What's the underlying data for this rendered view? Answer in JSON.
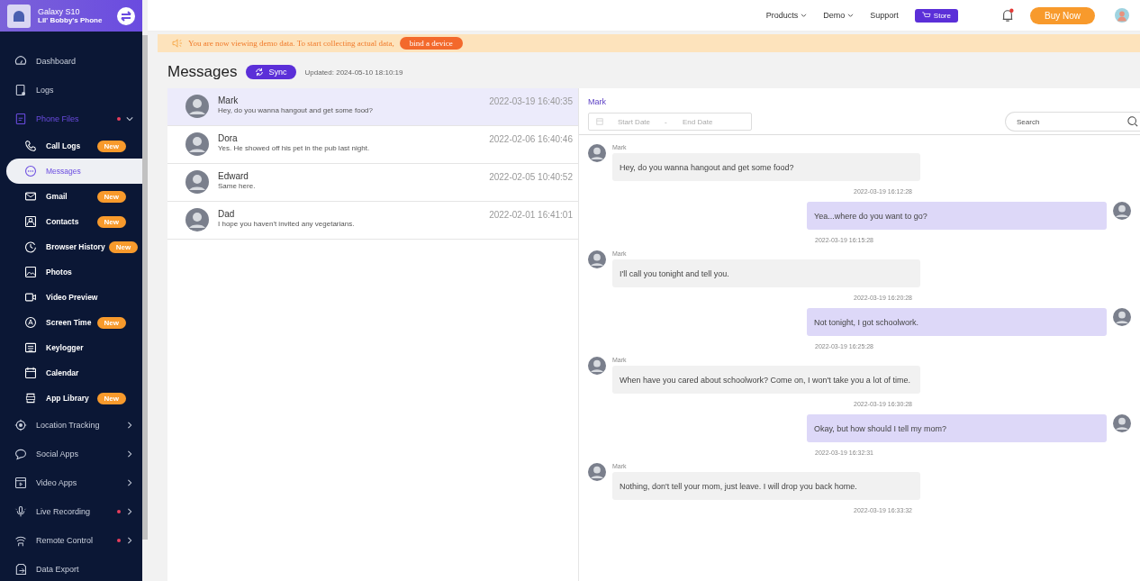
{
  "device": {
    "model": "Galaxy S10",
    "name": "Lil' Bobby's Phone"
  },
  "sidebar": {
    "items": [
      {
        "label": "Dashboard",
        "selected": false
      },
      {
        "label": "Logs",
        "selected": false
      },
      {
        "label": "Phone Files",
        "selected": true,
        "dot": true,
        "expanded": true,
        "children": [
          {
            "label": "Call Logs",
            "badge": "New",
            "selected": false
          },
          {
            "label": "Messages",
            "selected": true
          },
          {
            "label": "Gmail",
            "badge": "New",
            "selected": false
          },
          {
            "label": "Contacts",
            "badge": "New",
            "selected": false
          },
          {
            "label": "Browser History",
            "badge": "New",
            "selected": false
          },
          {
            "label": "Photos",
            "selected": false
          },
          {
            "label": "Video Preview",
            "selected": false
          },
          {
            "label": "Screen Time",
            "badge": "New",
            "selected": false
          },
          {
            "label": "Keylogger",
            "selected": false
          },
          {
            "label": "Calendar",
            "selected": false
          },
          {
            "label": "App Library",
            "badge": "New",
            "selected": false
          }
        ]
      },
      {
        "label": "Location Tracking",
        "selected": false,
        "dot": false,
        "expanded": false
      },
      {
        "label": "Social Apps",
        "selected": false,
        "dot": false,
        "expanded": false
      },
      {
        "label": "Video Apps",
        "selected": false,
        "dot": false,
        "expanded": false
      },
      {
        "label": "Live Recording",
        "selected": false,
        "dot": true,
        "expanded": false
      },
      {
        "label": "Remote Control",
        "selected": false,
        "dot": true,
        "expanded": false
      },
      {
        "label": "Data Export",
        "selected": false
      }
    ]
  },
  "topnav": {
    "links": [
      {
        "label": "Products",
        "dropdown": true
      },
      {
        "label": "Demo",
        "dropdown": true
      },
      {
        "label": "Support",
        "dropdown": false
      }
    ],
    "store": "Store",
    "notification": true,
    "buy": "Buy Now"
  },
  "banner": {
    "text": "You are now viewing demo data. To start collecting actual data,",
    "button": "bind a device"
  },
  "page": {
    "title": "Messages",
    "sync": "Sync",
    "updated": "Updated: 2024-05-10 18:10:19"
  },
  "conversations": [
    {
      "name": "Mark",
      "preview": "Hey, do you wanna hangout and get some food?",
      "time": "2022-03-19 16:40:35",
      "selected": true
    },
    {
      "name": "Dora",
      "preview": "Yes. He showed off his pet in the pub last night.",
      "time": "2022-02-06 16:40:46",
      "selected": false
    },
    {
      "name": "Edward",
      "preview": "Same here.",
      "time": "2022-02-05 10:40:52",
      "selected": false
    },
    {
      "name": "Dad",
      "preview": "I hope you haven't invited any vegetarians.",
      "time": "2022-02-01 16:41:01",
      "selected": false
    }
  ],
  "chat": {
    "contact": "Mark",
    "start_placeholder": "Start Date",
    "separator": "-",
    "end_placeholder": "End Date",
    "search_placeholder": "Search",
    "messages": [
      {
        "kind": "received",
        "sender": "Mark",
        "text": "Hey, do you wanna hangout and get some food?",
        "time": "2022-03-19 16:12:28"
      },
      {
        "kind": "sent",
        "text": "Yea...where do you want to go?",
        "time": "2022-03-19 16:15:28"
      },
      {
        "kind": "received",
        "sender": "Mark",
        "text": "I'll call you tonight and tell you.",
        "time": "2022-03-19 16:20:28"
      },
      {
        "kind": "sent",
        "text": "Not tonight, I got schoolwork.",
        "time": "2022-03-19 16:25:28"
      },
      {
        "kind": "received",
        "sender": "Mark",
        "text": "When have you cared about schoolwork? Come on, I won't take you a lot of time.",
        "time": "2022-03-19 16:30:28"
      },
      {
        "kind": "sent",
        "text": "Okay, but how should I tell my mom?",
        "time": "2022-03-19 16:32:31"
      },
      {
        "kind": "received",
        "sender": "Mark",
        "text": "Nothing, don't tell your mom, just leave. I will drop you back home.",
        "time": "2022-03-19 16:33:32"
      }
    ]
  }
}
